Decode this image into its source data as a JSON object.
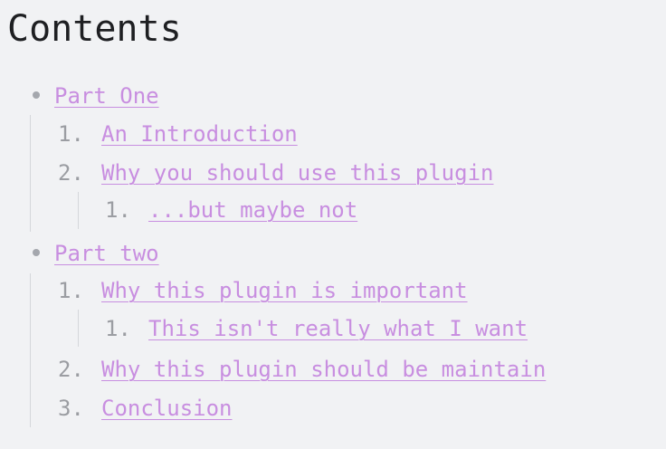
{
  "title": "Contents",
  "toc": [
    {
      "label": "Part One",
      "children": [
        {
          "num": "1.",
          "label": "An Introduction"
        },
        {
          "num": "2.",
          "label": "Why you should use this plugin",
          "children": [
            {
              "num": "1.",
              "label": "...but maybe not"
            }
          ]
        }
      ]
    },
    {
      "label": "Part two",
      "children": [
        {
          "num": "1.",
          "label": "Why this plugin is important",
          "children": [
            {
              "num": "1.",
              "label": "This isn't really what I want"
            }
          ]
        },
        {
          "num": "2.",
          "label": "Why this plugin should be maintain"
        },
        {
          "num": "3.",
          "label": "Conclusion"
        }
      ]
    }
  ]
}
